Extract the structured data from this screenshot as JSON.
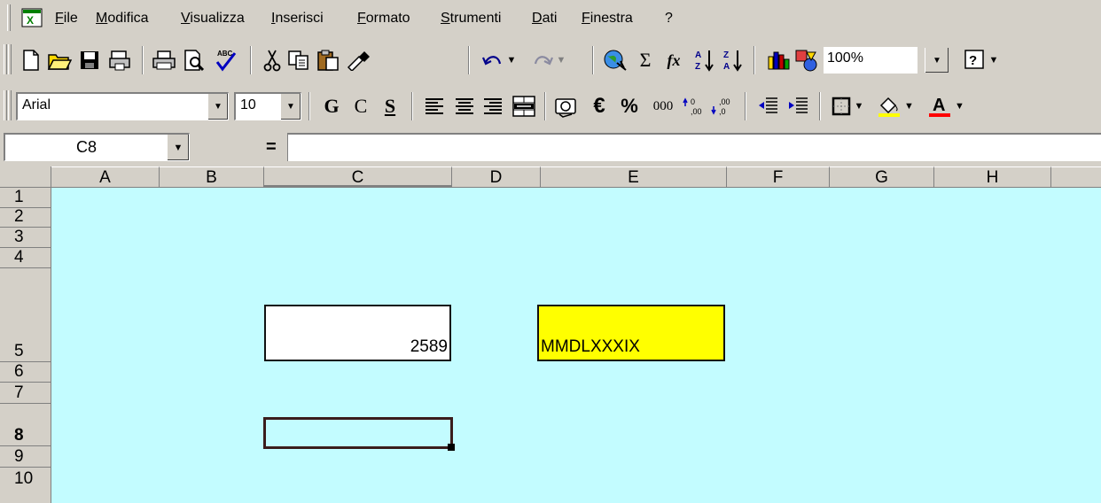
{
  "menu": {
    "items": [
      "File",
      "Modifica",
      "Visualizza",
      "Inserisci",
      "Formato",
      "Strumenti",
      "Dati",
      "Finestra",
      "?"
    ]
  },
  "standard_toolbar": {
    "icons": [
      "new-icon",
      "open-icon",
      "save-icon",
      "permissions-icon",
      "print-icon",
      "print-preview-icon",
      "spelling-icon",
      "cut-icon",
      "copy-icon",
      "paste-icon",
      "format-painter-icon",
      "undo-icon",
      "redo-icon",
      "web-icon",
      "autosum-icon",
      "function-icon",
      "sort-ascending-icon",
      "sort-descending-icon",
      "chart-wizard-icon",
      "drawing-icon",
      "help-icon"
    ],
    "autosum_glyph": "Σ",
    "function_glyph": "fx",
    "zoom": "100%"
  },
  "formatting_toolbar": {
    "font": "Arial",
    "size": "10",
    "bold": "G",
    "italic": "C",
    "underline": "S",
    "currency": "€",
    "percent": "%",
    "thousands": "000"
  },
  "formula_bar": {
    "name_box": "C8",
    "equals": "=",
    "formula": ""
  },
  "sheet": {
    "columns": [
      "A",
      "B",
      "C",
      "D",
      "E",
      "F",
      "G",
      "H"
    ],
    "rows": [
      "1",
      "2",
      "3",
      "4",
      "5",
      "6",
      "7",
      "8",
      "9",
      "10"
    ],
    "active_column": "C",
    "active_row": "8",
    "cells": {
      "C5": "2589",
      "E5": "MMDLXXXIX",
      "C8": ""
    },
    "colors": {
      "sheet_background": "#c3fcff",
      "E5_fill": "#ffff00",
      "C5_fill": "#ffffff"
    }
  }
}
